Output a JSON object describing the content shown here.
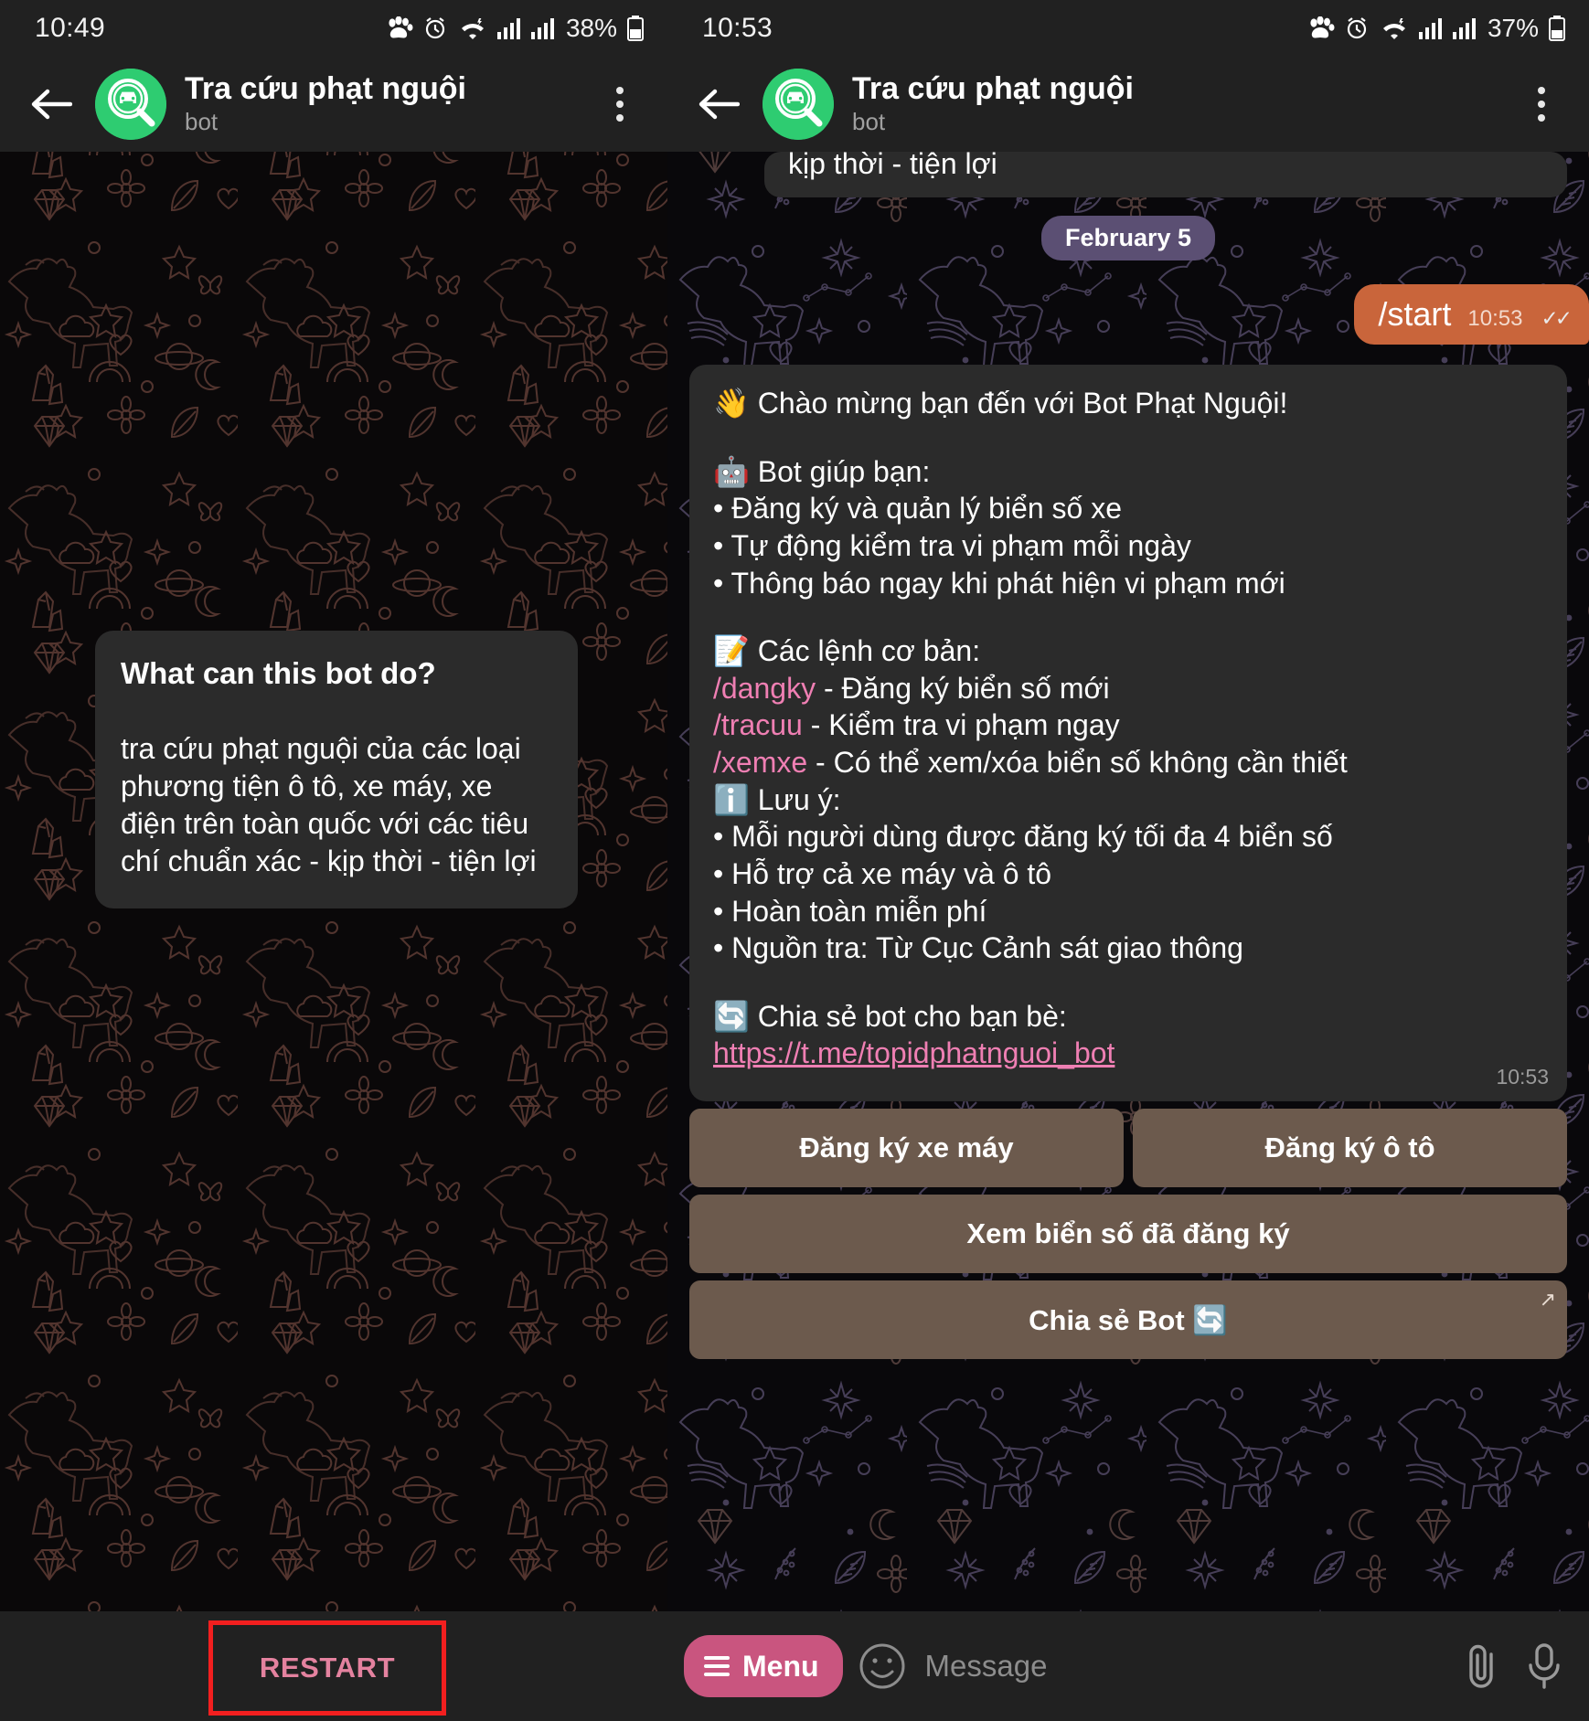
{
  "left": {
    "status": {
      "time": "10:49",
      "battery": "38%"
    },
    "header": {
      "title": "Tra cứu phạt nguội",
      "subtitle": "bot"
    },
    "bubble": {
      "title": "What can this bot do?",
      "body": "tra cứu phạt nguội của các loại phương tiện ô tô, xe máy, xe điện trên toàn quốc với các tiêu chí chuẩn xác - kịp thời - tiện lợi"
    },
    "restart_label": "RESTART"
  },
  "right": {
    "status": {
      "time": "10:53",
      "battery": "37%"
    },
    "header": {
      "title": "Tra cứu phạt nguội",
      "subtitle": "bot"
    },
    "cut_message": "kịp thời - tiện lợi",
    "date_divider": "February 5",
    "outgoing": {
      "text": "/start",
      "time": "10:53",
      "ticks": "✓✓"
    },
    "welcome": {
      "greeting": "👋 Chào mừng bạn đến với Bot Phạt Nguội!",
      "help_heading": "🤖 Bot giúp bạn:",
      "help_items": [
        "• Đăng ký và quản lý biển số xe",
        "• Tự động kiểm tra vi phạm mỗi ngày",
        "• Thông báo ngay khi phát hiện vi phạm mới"
      ],
      "commands_heading": "📝 Các lệnh cơ bản:",
      "commands": [
        {
          "cmd": "/dangky",
          "desc": " - Đăng ký biển số mới"
        },
        {
          "cmd": "/tracuu",
          "desc": " - Kiểm tra vi phạm ngay"
        },
        {
          "cmd": "/xemxe",
          "desc": " - Có thể xem/xóa biển số không cần thiết"
        }
      ],
      "note_heading": "ℹ️ Lưu ý:",
      "notes": [
        "• Mỗi người dùng được đăng ký tối đa 4 biển số",
        "• Hỗ trợ cả xe máy và ô tô",
        "• Hoàn toàn miễn phí",
        "• Nguồn tra: Từ Cục Cảnh sát giao thông"
      ],
      "share_heading": "🔄 Chia sẻ bot cho bạn bè:",
      "share_url": "https://t.me/topidphatnguoi_bot",
      "time": "10:53"
    },
    "keyboard": [
      [
        {
          "label": "Đăng ký xe máy",
          "external": ""
        },
        {
          "label": "Đăng ký ô tô",
          "external": ""
        }
      ],
      [
        {
          "label": "Xem biển số đã đăng ký",
          "external": ""
        }
      ],
      [
        {
          "label": "Chia sẻ Bot 🔄",
          "external": "↗"
        }
      ]
    ],
    "inputbar": {
      "menu_label": "Menu",
      "placeholder": "Message"
    }
  },
  "colors": {
    "accent_out": "#c9653b",
    "date_pill": "#5b4f73",
    "link": "#ef7fb3",
    "keyboard_btn": "#6c5a4d",
    "menu_btn": "#c9557f",
    "avatar": "#2ecc71",
    "restart_text": "#e4829f",
    "highlight_border": "#f21f1f"
  }
}
